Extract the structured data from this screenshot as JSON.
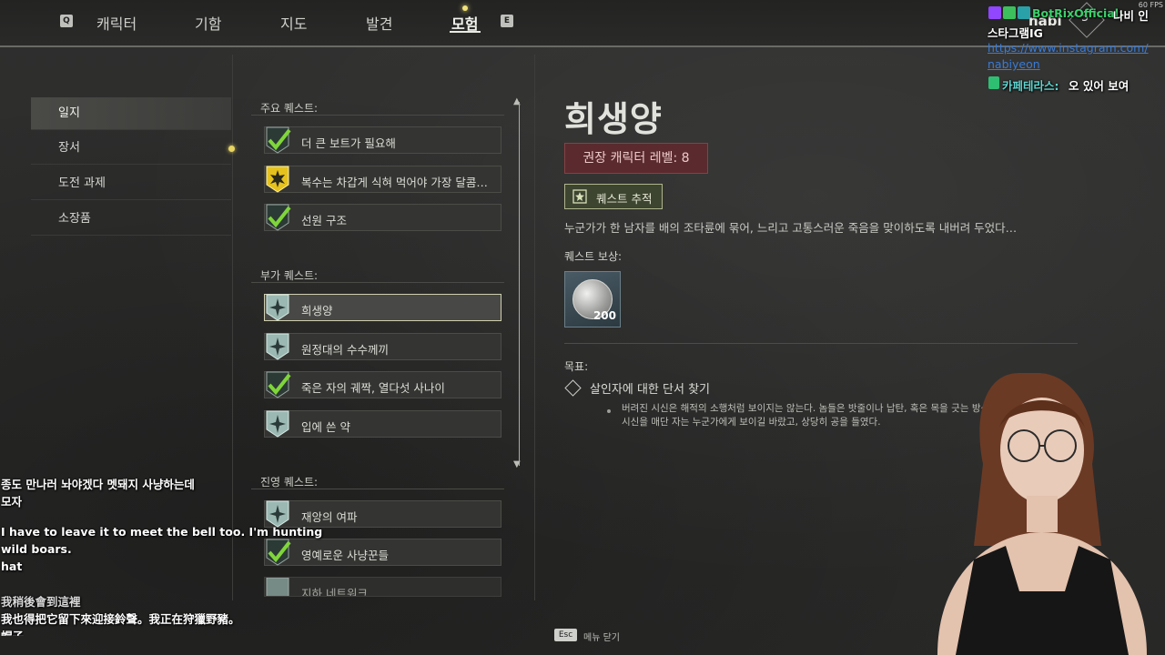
{
  "nav": {
    "left_key": "Q",
    "right_key": "E",
    "tabs": [
      "캐릭터",
      "기함",
      "지도",
      "발견",
      "모험"
    ],
    "active_tab": "모험"
  },
  "menu": {
    "items": [
      "일지",
      "장서",
      "도전 과제",
      "소장품"
    ],
    "active": "일지"
  },
  "quests": {
    "main_label": "주요 퀘스트:",
    "main": [
      "더 큰 보트가 필요해",
      "복수는 차갑게 식혀 먹어야 가장 달콤…",
      "선원 구조"
    ],
    "side_label": "부가 퀘스트:",
    "side": [
      "희생양",
      "원정대의 수수께끼",
      "죽은 자의 궤짝, 열다섯 사나이",
      "입에 쓴 약"
    ],
    "faction_label": "진영 퀘스트:",
    "faction": [
      "재앙의 여파",
      "영예로운 사냥꾼들",
      "지하 네트워크"
    ]
  },
  "detail": {
    "title": "희생양",
    "level_badge": "권장 캐릭터 레벨: 8",
    "track_button": "퀘스트 추적",
    "description": "누군가가 한 남자를 배의 조타륜에 묶어, 느리고 고통스러운 죽음을 맞이하도록 내버려 두었다…",
    "reward_label": "퀘스트 보상:",
    "reward_count": "200",
    "objective_label": "목표:",
    "objective": "살인자에 대한 단서 찾기",
    "objective_desc_1": "버려진 시신은 해적의 소행처럼 보이지는 않는다. 놈들은 밧줄이나 납탄, 혹은 목을 긋는 방식을",
    "objective_desc_2": "시신을 매단 자는 누군가에게 보이길 바랐고, 상당히 공을 들였다."
  },
  "footer": {
    "esc_key": "Esc",
    "esc_label": "메뉴 닫기"
  },
  "player": {
    "name": "nabi",
    "level": "5"
  },
  "overlay": {
    "fps": "60 FPS",
    "chat1_user": "BotRixOfficial:",
    "chat1_text": "나비 인",
    "chat1_line2": "스타그램IG",
    "chat1_link1": "https://www.instagram.com/",
    "chat1_link2": "nabiyeon",
    "chat2_user": "카페테라스:",
    "chat2_text": "오 있어 보여",
    "sub1": "종도 만나러 놔야겠다 멧돼지 사냥하는데",
    "sub2": "모자",
    "sub3": "I have to leave it to meet the bell too. I'm hunting",
    "sub4": "wild boars.",
    "sub5": "hat",
    "sub6": "我稍後會到這裡",
    "sub7": "我也得把它留下來迎接鈴聲。我正在狩獵野豬。",
    "sub8": "帽子"
  },
  "colors": {
    "accent_gold": "#f1e27a",
    "check_green": "#7fd63a",
    "level_badge_bg": "#5a2a2e",
    "track_button_bg": "#3d4430"
  },
  "icons": {
    "completed": "checkmark-icon",
    "main_active": "gold-burst-icon",
    "side": "compass-star-icon"
  }
}
